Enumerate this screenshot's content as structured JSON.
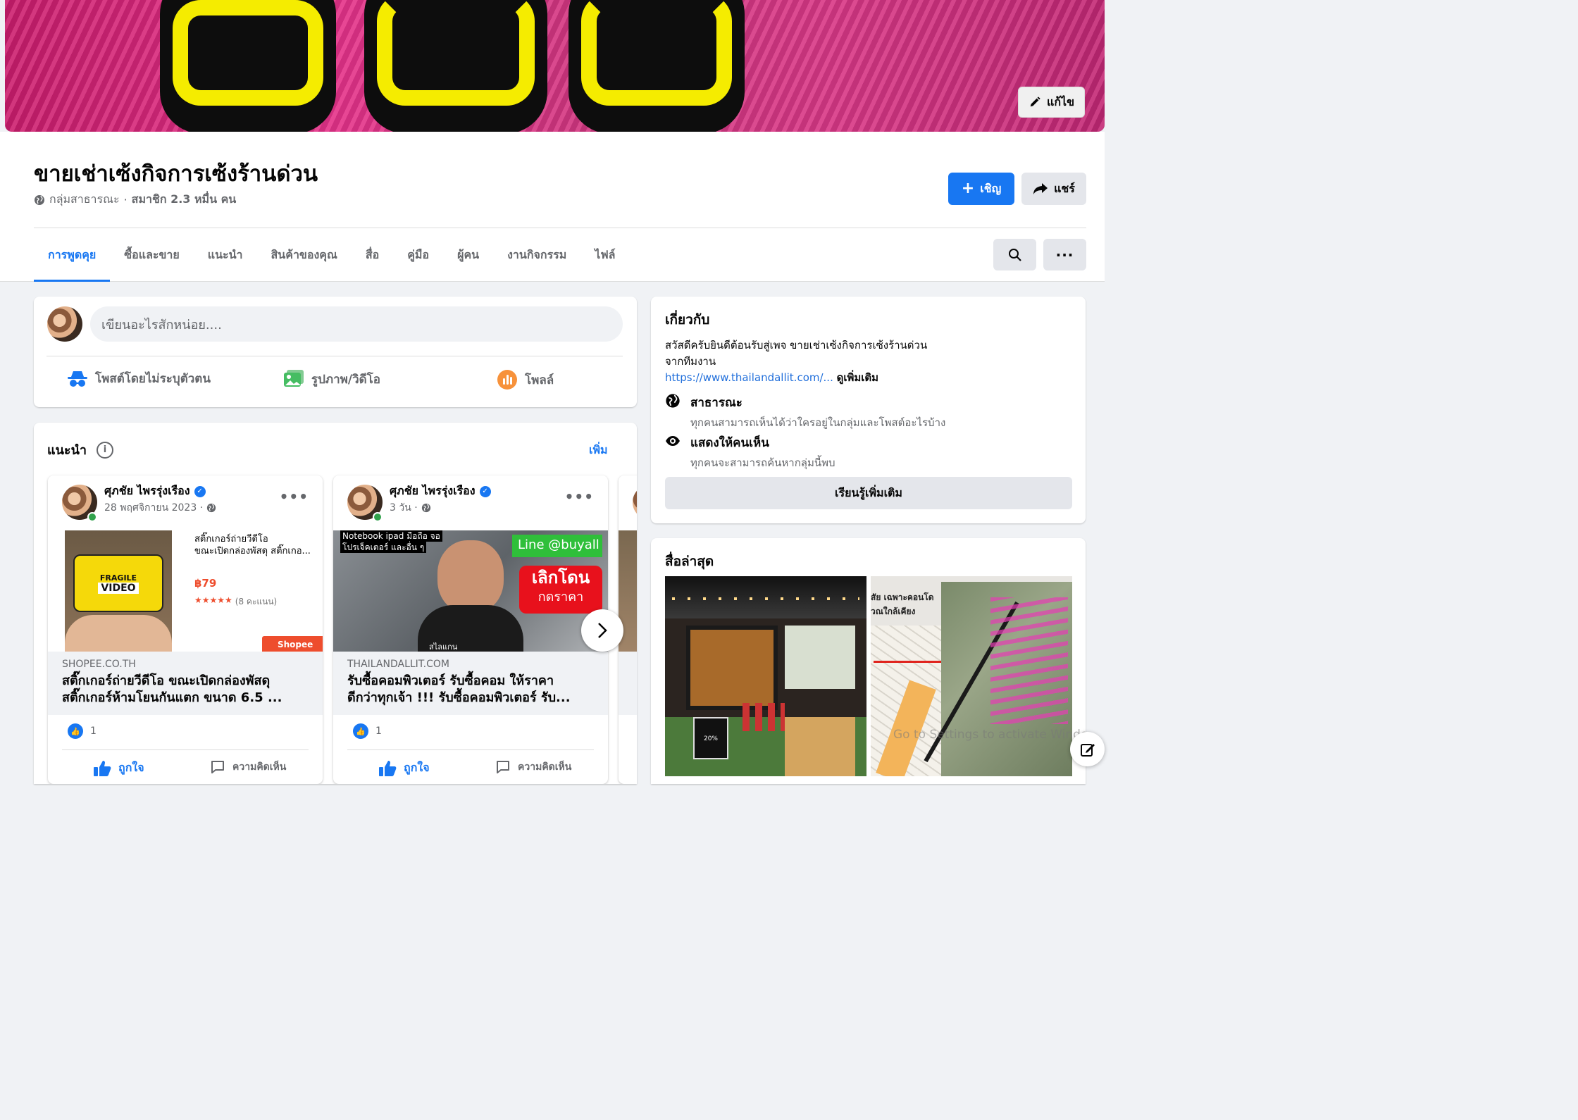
{
  "cover": {
    "edit_label": "แก้ไข"
  },
  "group": {
    "title": "ขายเช่าเซ้งกิจการเซ้งร้านด่วน",
    "privacy": "กลุ่มสาธารณะ",
    "separator": "·",
    "members": "สมาชิก 2.3 หมื่น คน",
    "invite_label": "เชิญ",
    "share_label": "แชร์"
  },
  "tabs": [
    "การพูดคุย",
    "ซื้อและขาย",
    "แนะนำ",
    "สินค้าของคุณ",
    "สื่อ",
    "คู่มือ",
    "ผู้คน",
    "งานกิจกรรม",
    "ไฟล์"
  ],
  "composer": {
    "placeholder": "เขียนอะไรสักหน่อย....",
    "actions": [
      "โพสต์โดยไม่ระบุตัวตน",
      "รูปภาพ/วิดีโอ",
      "โพลล์"
    ]
  },
  "suggested": {
    "title": "แนะนำ",
    "more": "เพิ่ม",
    "posts": [
      {
        "author": "ศุภชัย ไพรรุ่งเรือง",
        "time": "28 พฤศจิกายน 2023 ·",
        "media": {
          "desc_line1": "สติ๊กเกอร์ถ่ายวีดีโอ",
          "desc_line2": "ขณะเปิดกล่องพัสดุ สติ๊กเกอ...",
          "price": "฿79",
          "rating": "(8 คะแนน)",
          "stars": "★★★★★",
          "tape_text": "FRAGILE",
          "tape_text2": "VIDEO",
          "badge": "Shopee"
        },
        "domain": "SHOPEE.CO.TH",
        "title_line1": "สติ๊กเกอร์ถ่ายวีดีโอ ขณะเปิดกล่องพัสดุ",
        "title_line2": "สติ๊กเกอร์ห้ามโยนกันแตก ขนาด 6.5 ...",
        "likes": "1",
        "like_label": "ถูกใจ",
        "comment_label": "ความคิดเห็น"
      },
      {
        "author": "ศุภชัย ไพรรุ่งเรือง",
        "time": "3 วัน ·",
        "media": {
          "caption_line1": "Notebook ipad มือถือ จอ",
          "caption_line2": "โปรเจ็คเตอร์ และอื่น ๆ",
          "line_tag": "Line @buyall",
          "red_text1": "เลิกโดน",
          "red_text2": "กดราคา",
          "footer_text": "สไลแกน"
        },
        "domain": "THAILANDALLIT.COM",
        "title_line1": "รับซื้อคอมพิวเตอร์ รับซื้อคอม ให้ราคา",
        "title_line2": "ดีกว่าทุกเจ้า !!! รับซื้อคอมพิวเตอร์ รับ...",
        "likes": "1",
        "like_label": "ถูกใจ",
        "comment_label": "ความคิดเห็น"
      }
    ]
  },
  "about": {
    "title": "เกี่ยวกับ",
    "desc_line1": "สวัสดีครับยินดีต้อนรับสู่เพจ ขายเช่าเซ้งกิจการเซ้งร้านด่วน",
    "desc_line2": "จากทีมงาน",
    "link": "https://www.thailandallit.com/...",
    "see_more": "ดูเพิ่มเติม",
    "public_title": "สาธารณะ",
    "public_desc": "ทุกคนสามารถเห็นได้ว่าใครอยู่ในกลุ่มและโพสต์อะไรบ้าง",
    "visible_title": "แสดงให้คนเห็น",
    "visible_desc": "ทุกคนจะสามารถค้นหากลุ่มนี้พบ",
    "learn_more": "เรียนรู้เพิ่มเติม"
  },
  "media": {
    "title": "สื่อล่าสุด",
    "map_label1": "สัย เฉพาะคอนโด",
    "map_label2": "วณใกล้เคียง",
    "sign_text": "20%"
  },
  "watermark": "Go to Settings to activate Windo",
  "colors": {
    "accent": "#1877f2",
    "background": "#f0f2f5",
    "cover_pink": "#d23c86",
    "cover_yellow": "#f5ec00"
  }
}
